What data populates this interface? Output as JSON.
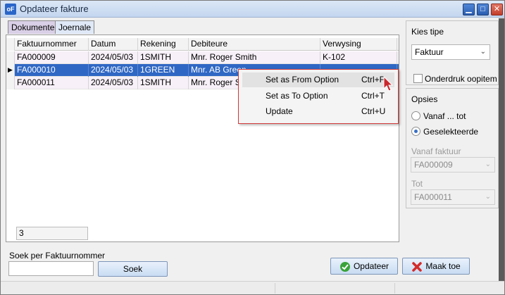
{
  "window": {
    "title": "Opdateer fakture",
    "app_icon": "oF"
  },
  "tabs": [
    {
      "label": "Dokumente",
      "active": true
    },
    {
      "label": "Joernale",
      "active": false
    }
  ],
  "grid": {
    "columns": [
      "Faktuurnommer",
      "Datum",
      "Rekening",
      "Debiteure",
      "Verwysing"
    ],
    "rows": [
      {
        "cells": [
          "FA000009",
          "2024/05/03",
          "1SMITH",
          "Mnr. Roger Smith",
          "K-102"
        ],
        "selected": false
      },
      {
        "cells": [
          "FA000010",
          "2024/05/03",
          "1GREEN",
          "Mnr. AB Green",
          ""
        ],
        "selected": true
      },
      {
        "cells": [
          "FA000011",
          "2024/05/03",
          "1SMITH",
          "Mnr. Roger Smith",
          ""
        ],
        "selected": false
      }
    ],
    "row_indicator": "▶",
    "count": "3"
  },
  "context_menu": {
    "items": [
      {
        "label": "Set as From Option",
        "shortcut": "Ctrl+F"
      },
      {
        "label": "Set as To Option",
        "shortcut": "Ctrl+T"
      },
      {
        "label": "Update",
        "shortcut": "Ctrl+U"
      }
    ]
  },
  "type_panel": {
    "label": "Kies tipe",
    "selected": "Faktuur",
    "suppress_label": "Onderdruk oopitem",
    "suppress_checked": false
  },
  "options_panel": {
    "title": "Opsies",
    "radio_range": "Vanaf ... tot",
    "radio_selected": "Geselekteerde",
    "selected_option": "Geselekteerde",
    "from_label": "Vanaf faktuur",
    "from_value": "FA000009",
    "to_label": "Tot",
    "to_value": "FA000011"
  },
  "search": {
    "label": "Soek per Faktuurnommer",
    "value": "",
    "button": "Soek"
  },
  "actions": {
    "update": "Opdateer",
    "close": "Maak toe"
  },
  "colors": {
    "selection": "#2f67c4",
    "menu_border": "#d23a3a",
    "update_icon": "#3aa23a",
    "close_icon": "#d42a2a"
  }
}
